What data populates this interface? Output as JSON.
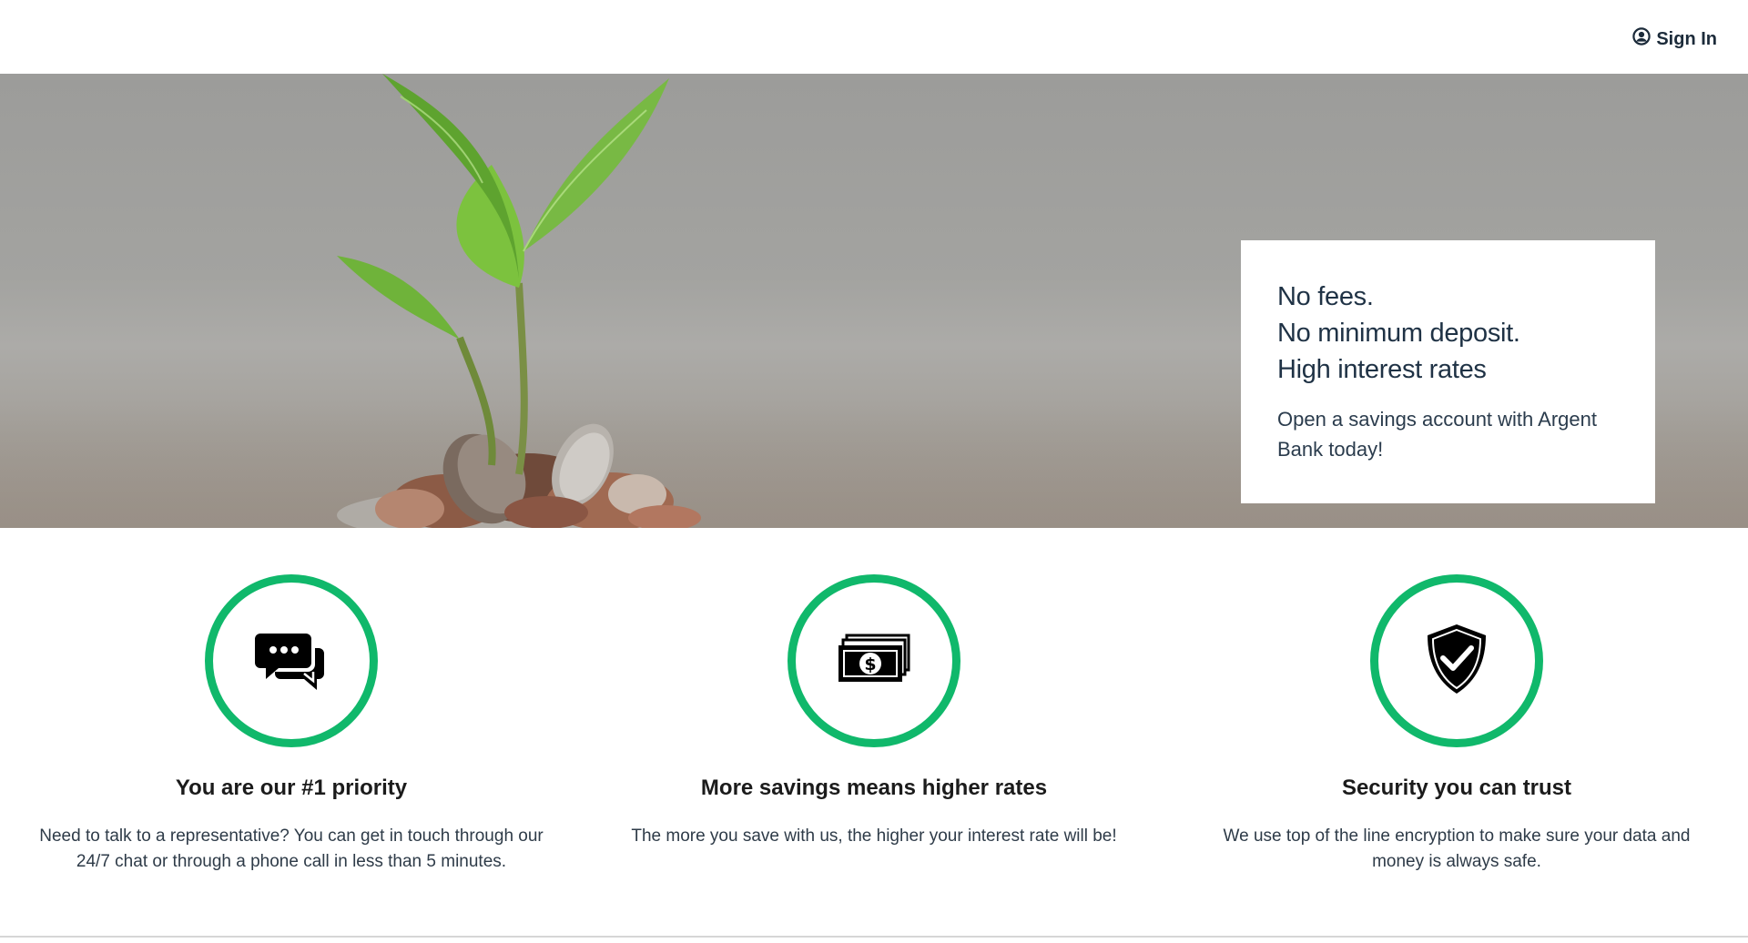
{
  "header": {
    "signin_label": "Sign In",
    "signin_icon": "user-circle-icon"
  },
  "hero": {
    "image": "plant-sprouting-from-coins",
    "headline_lines": [
      "No fees.",
      "No minimum deposit.",
      "High interest rates"
    ],
    "subtext": "Open a savings account with Argent Bank today!"
  },
  "features": [
    {
      "icon": "chat-icon",
      "title": "You are our #1 priority",
      "description": "Need to talk to a representative? You can get in touch through our 24/7 chat or through a phone call in less than 5 minutes."
    },
    {
      "icon": "money-icon",
      "title": "More savings means higher rates",
      "description": "The more you save with us, the higher your interest rate will be!"
    },
    {
      "icon": "shield-check-icon",
      "title": "Security you can trust",
      "description": "We use top of the line encryption to make sure your data and money is always safe."
    }
  ],
  "colors": {
    "accent": "#10b86b",
    "heading": "#1f3245"
  }
}
